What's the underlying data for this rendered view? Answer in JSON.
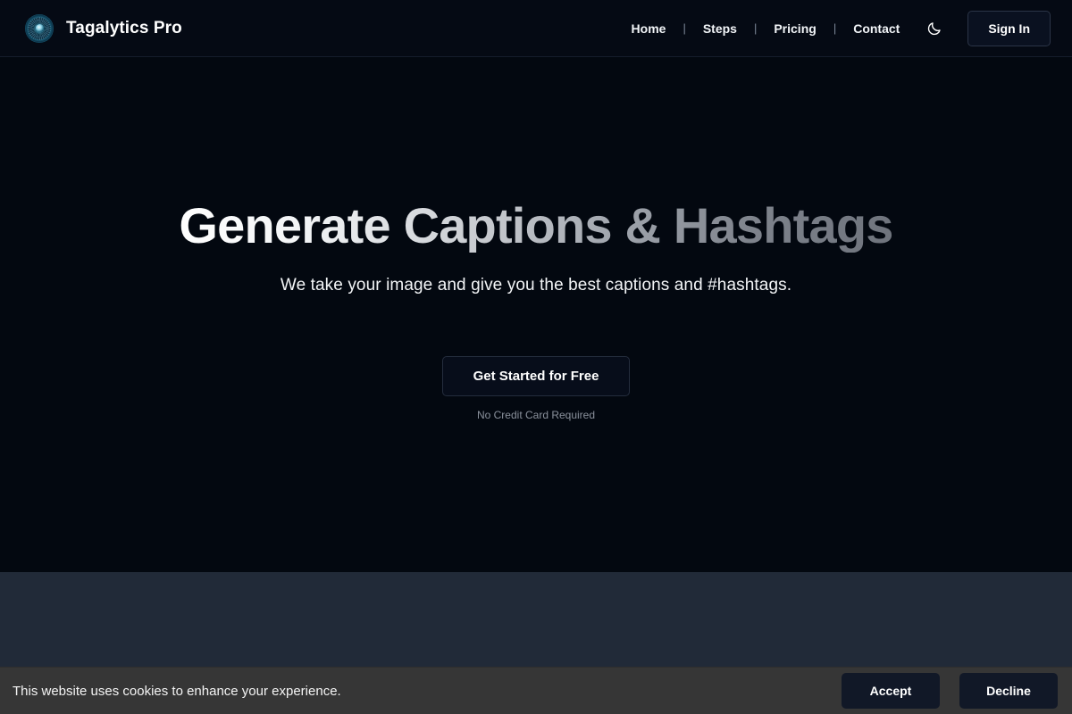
{
  "header": {
    "logo_icon": "circular-eye-mandala-logo",
    "brand_name": "Tagalytics Pro",
    "nav": [
      {
        "label": "Home"
      },
      {
        "label": "Steps"
      },
      {
        "label": "Pricing"
      },
      {
        "label": "Contact"
      }
    ],
    "separator": "|",
    "theme_toggle_icon": "moon-icon",
    "signin_label": "Sign In"
  },
  "hero": {
    "title": "Generate Captions & Hashtags",
    "subtitle": "We take your image and give you the best captions and #hashtags.",
    "cta_label": "Get Started for Free",
    "cta_note": "No Credit Card Required"
  },
  "cookie_banner": {
    "message": "This website uses cookies to enhance your experience.",
    "accept_label": "Accept",
    "decline_label": "Decline"
  },
  "colors": {
    "header_bg": "#050a14",
    "hero_bg": "#030810",
    "band_bg": "#212a38",
    "cookie_bg": "#363636",
    "cookie_button_bg": "#111827",
    "text_primary": "#ffffff",
    "text_muted": "#8a919c"
  }
}
